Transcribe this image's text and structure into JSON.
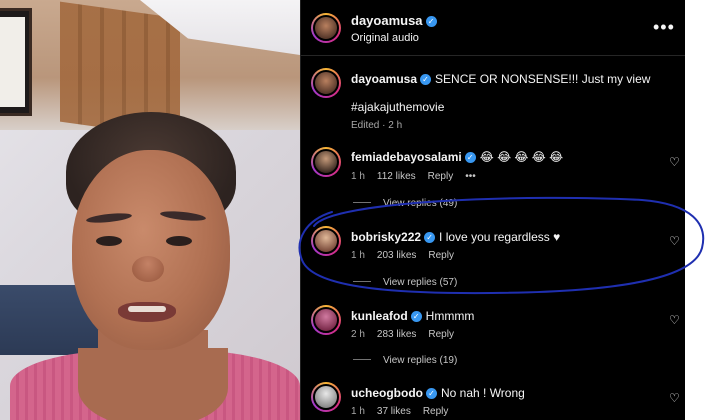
{
  "header": {
    "username": "dayoamusa",
    "subtitle": "Original audio",
    "more_label": "•••"
  },
  "caption": {
    "username": "dayoamusa",
    "text": "SENCE OR NONSENSE!!! Just my view",
    "hashtag": "#ajakajuthemovie",
    "meta": "Edited · 2 h"
  },
  "comments": [
    {
      "username": "femiadebayosalami",
      "text": "😂 😂 😂 😂 😂",
      "time": "1 h",
      "likes": "112 likes",
      "reply": "Reply",
      "more": "•••",
      "view_replies": "View replies (49)"
    },
    {
      "username": "bobrisky222",
      "text": "I love you regardless ♥",
      "time": "1 h",
      "likes": "203 likes",
      "reply": "Reply",
      "view_replies": "View replies (57)"
    },
    {
      "username": "kunleafod",
      "text": "Hmmmm",
      "time": "2 h",
      "likes": "283 likes",
      "reply": "Reply",
      "view_replies": "View replies (19)"
    },
    {
      "username": "ucheogbodo",
      "text": "No nah ! Wrong",
      "time": "1 h",
      "likes": "37 likes",
      "reply": "Reply"
    }
  ],
  "icons": {
    "verified": "verified-badge-icon",
    "heart": "heart-outline-icon",
    "more": "more-horizontal-icon"
  },
  "colors": {
    "panel_bg": "#000000",
    "verified_blue": "#3897f0",
    "annotation_ink": "#1f2fb0"
  }
}
